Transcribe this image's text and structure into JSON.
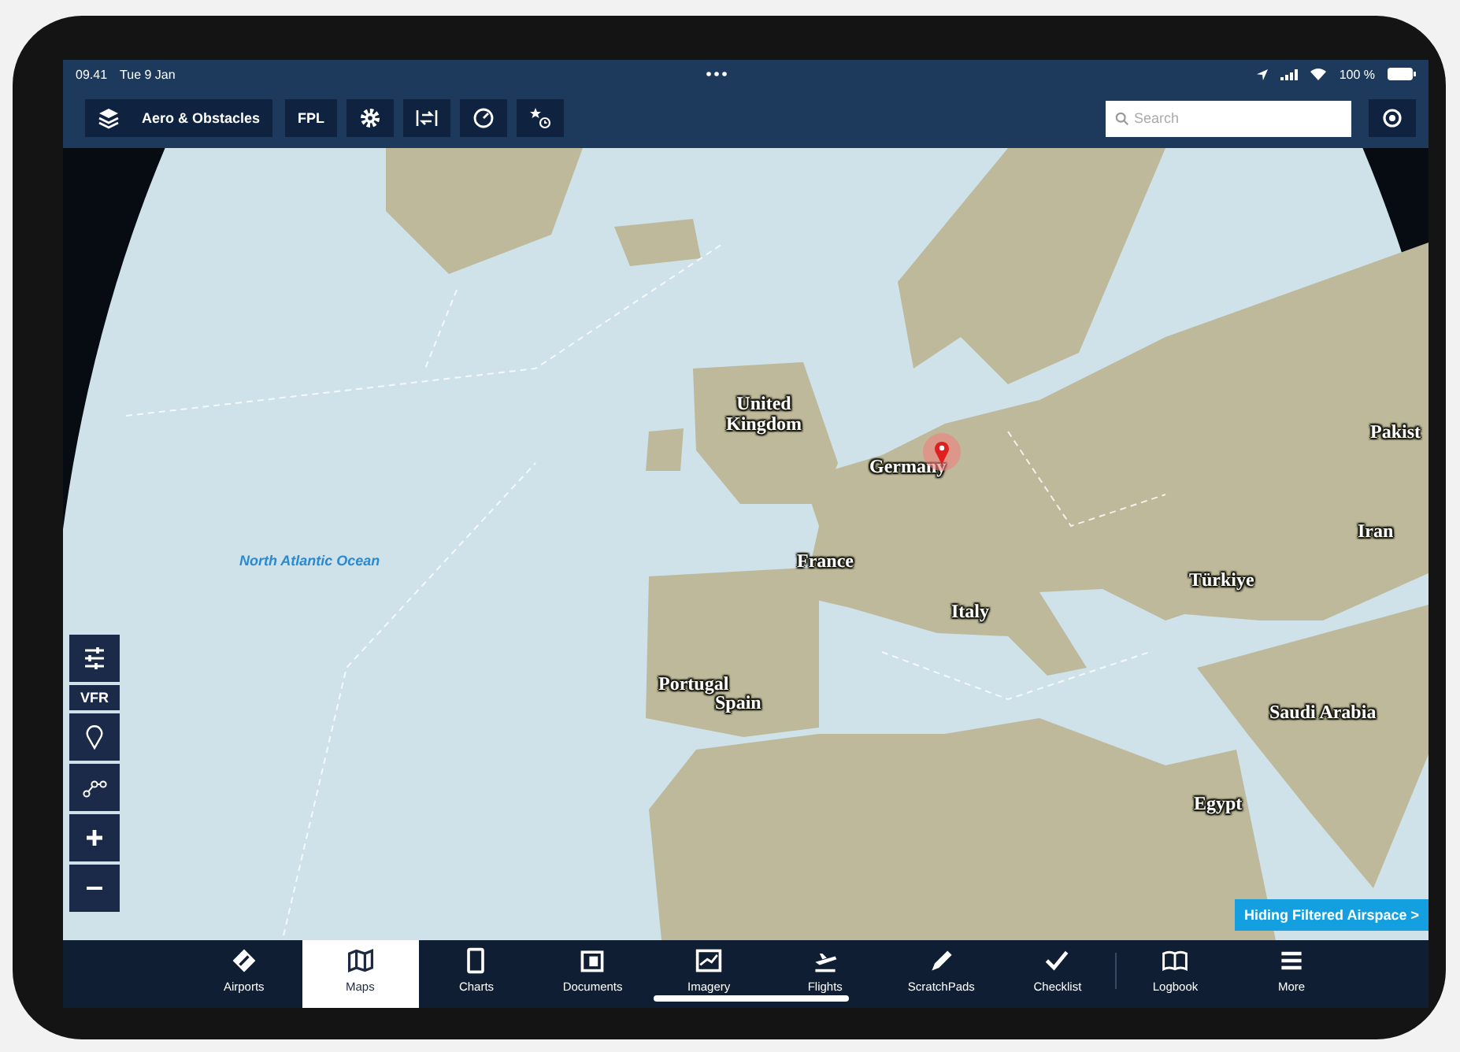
{
  "status_bar": {
    "time": "09.41",
    "date": "Tue 9 Jan",
    "battery": "100 %"
  },
  "toolbar": {
    "layers_button": "Aero & Obstacles",
    "fpl_button": "FPL",
    "search": {
      "placeholder": "Search"
    }
  },
  "map": {
    "labels": [
      {
        "text": "Pakist",
        "kind": "country"
      },
      {
        "text": "United Kingdom",
        "kind": "country"
      },
      {
        "text": "Germany",
        "kind": "country"
      },
      {
        "text": "Iran",
        "kind": "country"
      },
      {
        "text": "North Atlantic Ocean",
        "kind": "ocean"
      },
      {
        "text": "France",
        "kind": "country"
      },
      {
        "text": "Türkiye",
        "kind": "country"
      },
      {
        "text": "Italy",
        "kind": "country"
      },
      {
        "text": "Portugal",
        "kind": "country"
      },
      {
        "text": "Spain",
        "kind": "country"
      },
      {
        "text": "Saudi Arabia",
        "kind": "country"
      },
      {
        "text": "Egypt",
        "kind": "country"
      }
    ],
    "vfr_button": "VFR",
    "airspace_notice": "Hiding Filtered Airspace >"
  },
  "tabs": [
    {
      "label": "Airports",
      "selected": false
    },
    {
      "label": "Maps",
      "selected": true
    },
    {
      "label": "Charts",
      "selected": false
    },
    {
      "label": "Documents",
      "selected": false
    },
    {
      "label": "Imagery",
      "selected": false
    },
    {
      "label": "Flights",
      "selected": false
    },
    {
      "label": "ScratchPads",
      "selected": false
    },
    {
      "label": "Checklist",
      "selected": false
    },
    {
      "label": "Logbook",
      "selected": false
    },
    {
      "label": "More",
      "selected": false
    }
  ]
}
